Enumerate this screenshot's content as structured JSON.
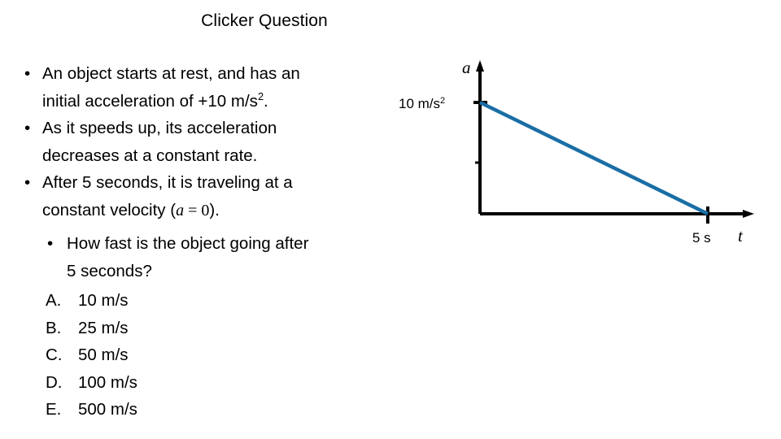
{
  "slide": {
    "title": "Clicker Question",
    "background_color": "#ffffff"
  },
  "body": {
    "bullets": [
      {
        "lines": [
          "An object starts at rest, and has an",
          "initial acceleration of +10 m/s²."
        ]
      },
      {
        "lines": [
          "As it speeds up, its acceleration",
          "decreases at a constant rate."
        ]
      },
      {
        "lines": [
          "After 5 seconds, it is traveling at a",
          "constant velocity (a = 0)."
        ]
      }
    ],
    "line1a": "An object starts at rest, and has an",
    "line1b_pre": "initial acceleration of +10 m/s",
    "line1b_sup": "2",
    "line1b_post": ".",
    "line2a": "As it speeds up, its acceleration",
    "line2b": "decreases at a constant rate.",
    "line3a": "After 5 seconds, it is traveling at a",
    "line3b_pre": "constant velocity (",
    "line3b_var": "a",
    "line3b_eq": " = ",
    "line3b_val": "0",
    "line3b_post": ").",
    "bullet_glyph": "•"
  },
  "question": {
    "bullet_glyph": "•",
    "line1": "How fast is the object going after",
    "line2": "5 seconds?"
  },
  "answers": [
    {
      "letter": "A.",
      "text": "10 m/s"
    },
    {
      "letter": "B.",
      "text": "25 m/s"
    },
    {
      "letter": "C.",
      "text": "50 m/s"
    },
    {
      "letter": "D.",
      "text": "100 m/s"
    },
    {
      "letter": "E.",
      "text": "500 m/s"
    }
  ],
  "chart_data": {
    "type": "line",
    "title": "",
    "xlabel": "t",
    "ylabel": "a",
    "x_axis_label": "t",
    "y_axis_label": "a",
    "x_tick_labels": [
      "5 s"
    ],
    "y_tick_labels": [
      "10 m/s²"
    ],
    "y_tick_label_value": "10 m/s",
    "y_tick_label_sup": "2",
    "x_tick_label_value": "5 s",
    "series": [
      {
        "name": "acceleration",
        "color": "#1a6ea5",
        "x": [
          0,
          5
        ],
        "y": [
          10,
          0
        ]
      }
    ],
    "xlim": [
      0,
      6
    ],
    "ylim": [
      0,
      12
    ],
    "grid": false,
    "legend": "none",
    "line_color": "#1a6ea5",
    "axis_color": "#000000"
  }
}
